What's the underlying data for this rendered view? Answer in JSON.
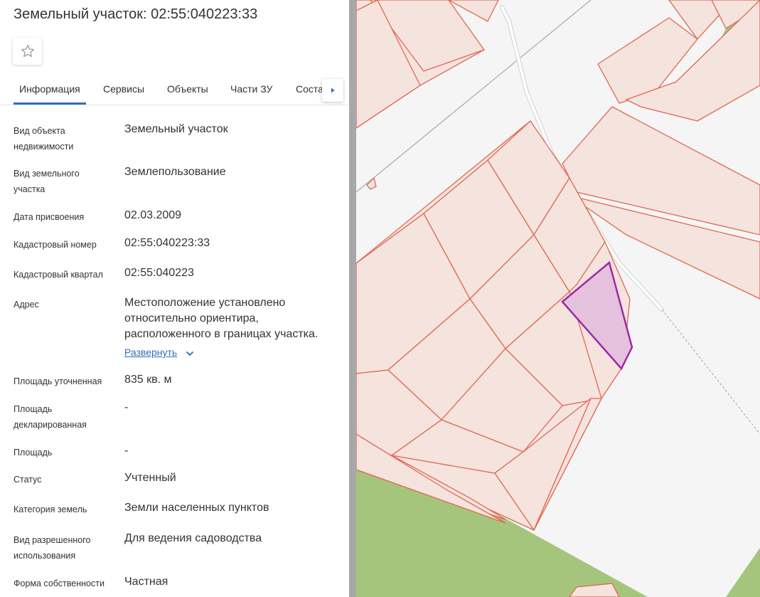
{
  "header": {
    "title": "Земельный участок: 02:55:040223:33"
  },
  "tabs": [
    {
      "label": "Информация",
      "active": true
    },
    {
      "label": "Сервисы"
    },
    {
      "label": "Объекты"
    },
    {
      "label": "Части ЗУ"
    },
    {
      "label": "Соста"
    }
  ],
  "fields": [
    {
      "label": "Вид объекта недвижимости",
      "value": "Земельный участок"
    },
    {
      "label": "Вид земельного участка",
      "value": "Землепользование"
    },
    {
      "label": "Дата присвоения",
      "value": "02.03.2009"
    },
    {
      "label": "Кадастровый номер",
      "value": "02:55:040223:33"
    },
    {
      "label": "Кадастровый квартал",
      "value": "02:55:040223"
    },
    {
      "label": "Адрес",
      "value": "Местоположение установлено относительно ориентира, расположенного в границах участка."
    },
    {
      "label": "Площадь уточненная",
      "value": "835 кв. м"
    },
    {
      "label": "Площадь декларированная",
      "value": "-"
    },
    {
      "label": "Площадь",
      "value": "-"
    },
    {
      "label": "Статус",
      "value": "Учтенный"
    },
    {
      "label": "Категория земель",
      "value": "Земли населенных пунктов"
    },
    {
      "label": "Вид разрешенного использования",
      "value": "Для ведения садоводства"
    },
    {
      "label": "Форма собственности",
      "value": "Частная"
    }
  ],
  "address_expand_label": "Развернуть",
  "icons": {
    "favorite": "star-icon",
    "tabs_next": "triangle-right-icon",
    "expand": "chevron-down-icon"
  },
  "colors": {
    "accent": "#2f6fb8",
    "parcel_fill": "#f5e3de",
    "parcel_stroke": "#e0684f",
    "selected_fill": "#e6c1dd",
    "selected_stroke": "#9b2aa6",
    "green_area": "#a5c57d",
    "divider": "#a8a8a8"
  }
}
